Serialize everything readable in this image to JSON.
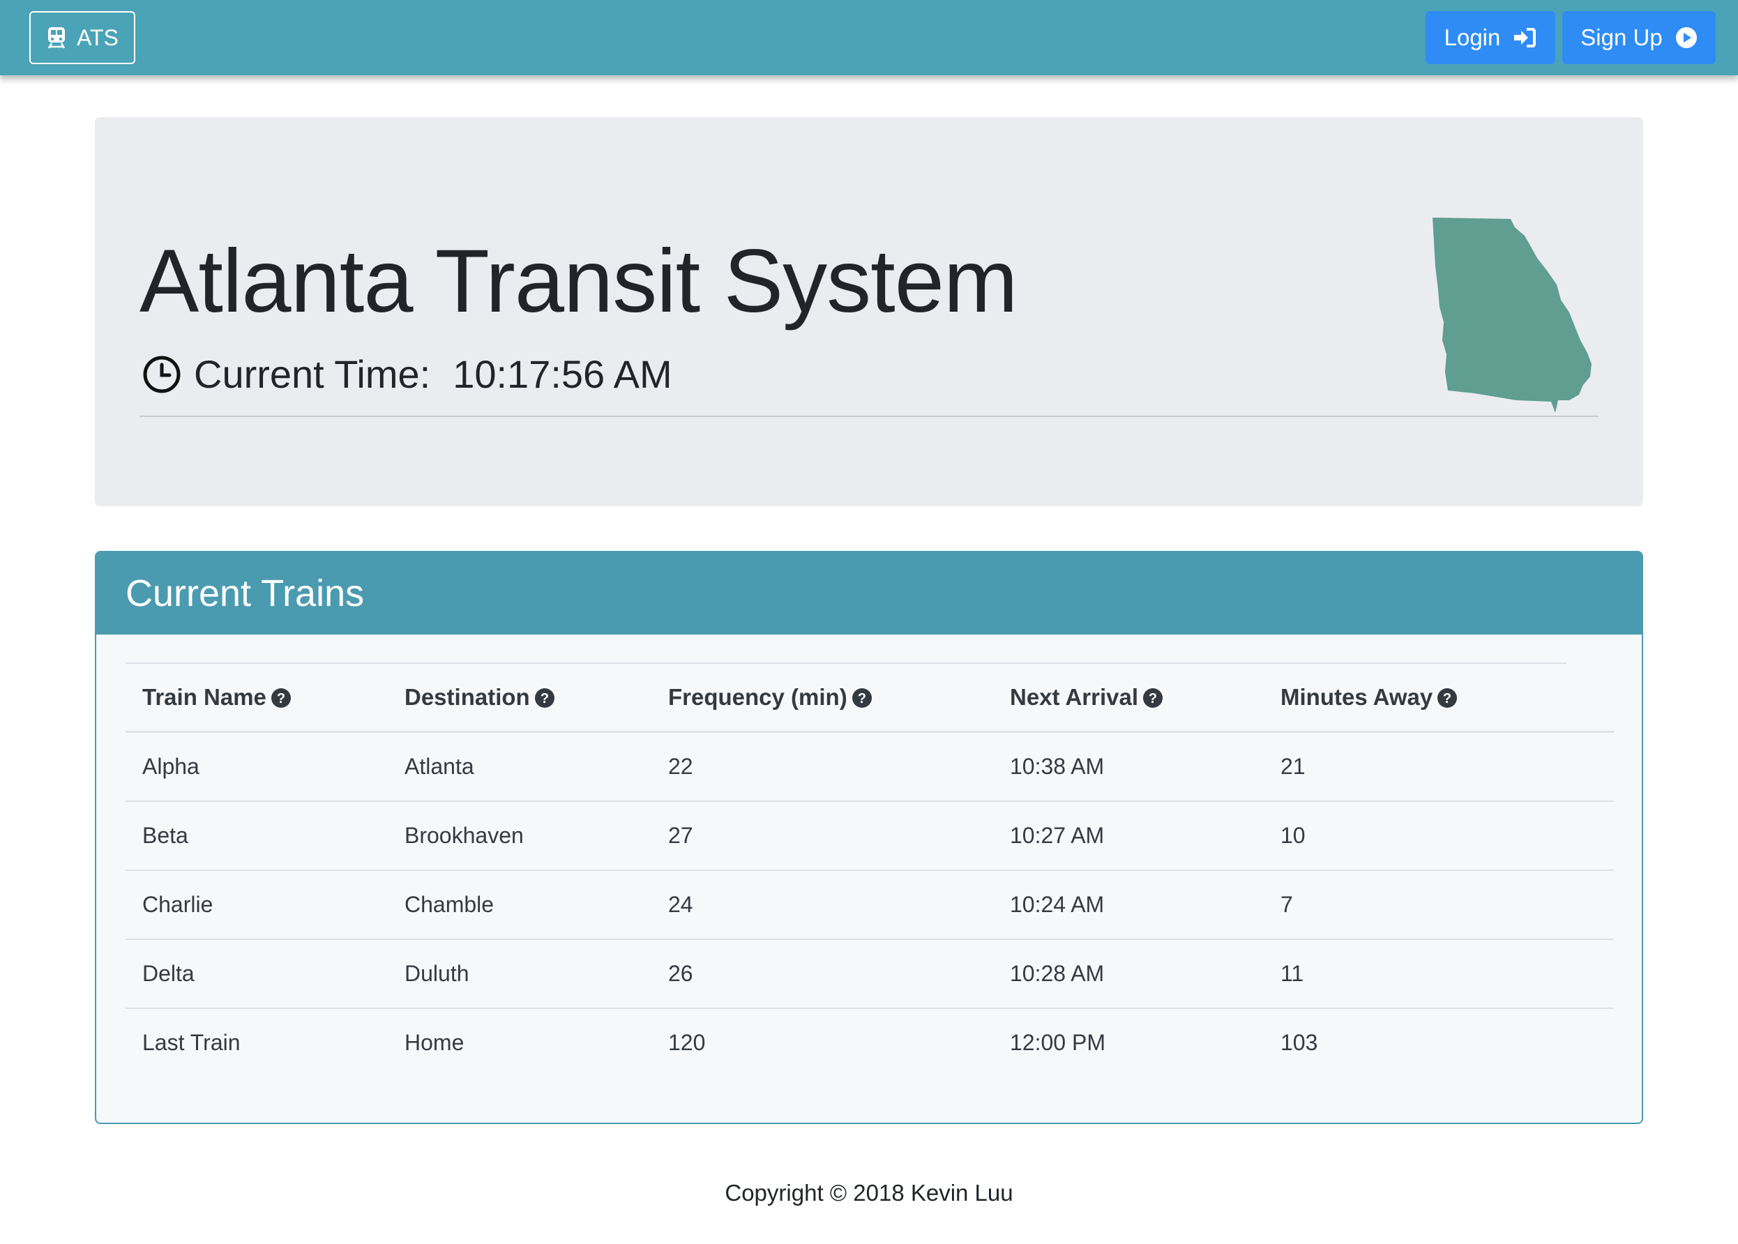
{
  "navbar": {
    "brand": "ATS",
    "login_label": "Login",
    "signup_label": "Sign Up"
  },
  "jumbotron": {
    "title": "Atlanta Transit System",
    "time_label": "Current Time:",
    "time_value": "10:17:56 AM"
  },
  "trains": {
    "title": "Current Trains",
    "columns": [
      "Train Name",
      "Destination",
      "Frequency (min)",
      "Next Arrival",
      "Minutes Away"
    ],
    "rows": [
      [
        "Alpha",
        "Atlanta",
        "22",
        "10:38 AM",
        "21"
      ],
      [
        "Beta",
        "Brookhaven",
        "27",
        "10:27 AM",
        "10"
      ],
      [
        "Charlie",
        "Chamble",
        "24",
        "10:24 AM",
        "7"
      ],
      [
        "Delta",
        "Duluth",
        "26",
        "10:28 AM",
        "11"
      ],
      [
        "Last Train",
        "Home",
        "120",
        "12:00 PM",
        "103"
      ]
    ]
  },
  "footer": {
    "copyright": "Copyright © 2018 Kevin Luu"
  },
  "icons": {
    "brand": "train-icon",
    "login": "sign-in-icon",
    "signup": "play-circle-icon",
    "time": "clock-icon",
    "column_help": "question-circle-icon",
    "map": "georgia-state-icon"
  },
  "colors": {
    "navbar": "#4ba3b7",
    "button": "#2f8cf5",
    "card_header": "#4a9bb0",
    "jumbotron": "#ebecf0",
    "map": "#5f9e91"
  }
}
